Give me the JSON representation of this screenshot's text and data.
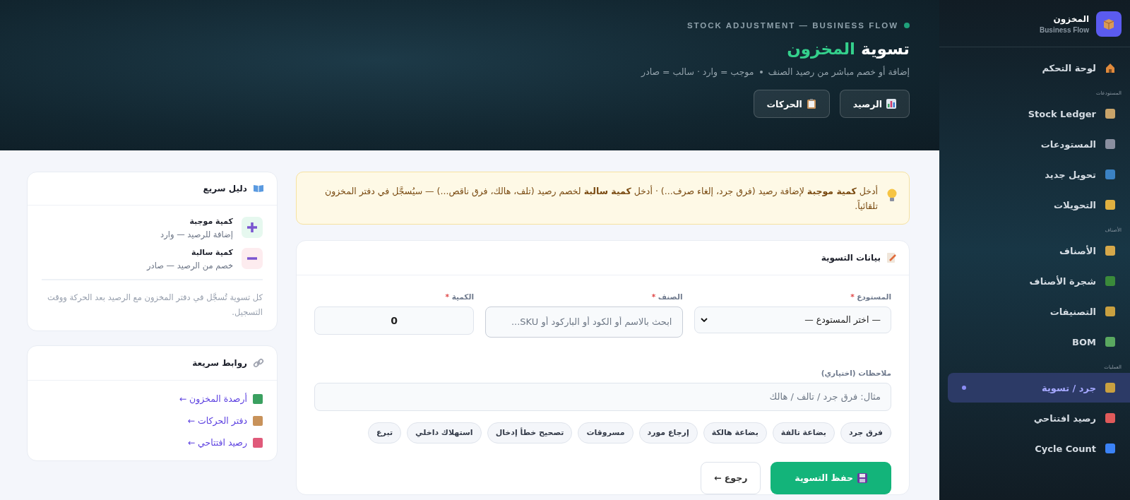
{
  "sidebar": {
    "brand": {
      "title": "المخزون",
      "subtitle": "Business Flow"
    },
    "top_items": [
      {
        "label": "لوحة التحكم",
        "selected": false
      }
    ],
    "groups": [
      {
        "label": "المستودعات",
        "items": [
          {
            "label": "Stock Ledger",
            "selected": false
          },
          {
            "label": "المستودعات",
            "selected": false
          },
          {
            "label": "تحويل جديد",
            "selected": false
          },
          {
            "label": "التحويلات",
            "selected": false
          }
        ]
      },
      {
        "label": "الأصناف",
        "items": [
          {
            "label": "الأصناف",
            "selected": false
          },
          {
            "label": "شجرة الأصناف",
            "selected": false
          },
          {
            "label": "التصنيفات",
            "selected": false
          },
          {
            "label": "BOM",
            "selected": false
          }
        ]
      },
      {
        "label": "العمليات",
        "items": [
          {
            "label": "جرد / تسوية",
            "selected": true
          },
          {
            "label": "رصيد افتتاحي",
            "selected": false
          },
          {
            "label": "Cycle Count",
            "selected": false
          }
        ]
      }
    ]
  },
  "header": {
    "eyebrow": "STOCK ADJUSTMENT — BUSINESS FLOW",
    "title": "تسوية",
    "title_highlight": "المخزون",
    "subtitle": [
      "إضافة أو خصم مباشر من رصيد الصنف",
      "موجب = وارد · سالب = صادر"
    ],
    "buttons": [
      "الرصيد",
      "الحركات"
    ]
  },
  "alert": "أدخل **كمية موجبة** لإضافة رصيد (فرق جرد، إلغاء صرف...) · أدخل **كمية سالبة** لخصم رصيد (تلف، هالك، فرق ناقص...) — سيُسجَّل في دفتر المخزون تلقائياً.",
  "form": {
    "title": "بيانات التسوية",
    "warehouse": {
      "label": "المستودع",
      "required_mark": "*",
      "value": "— اختر المستودع —"
    },
    "item": {
      "label": "الصنف",
      "required_mark": "*",
      "placeholder": "ابحث بالاسم أو الكود أو الباركود أو SKU..."
    },
    "quantity": {
      "label": "الكمية",
      "required_mark": "*",
      "value": "0"
    },
    "notes": {
      "label": "ملاحظات (اختياري)",
      "placeholder": "مثال: فرق جرد / تالف / هالك"
    },
    "chips": [
      "فرق جرد",
      "بضاعة تالفة",
      "بضاعة هالكة",
      "إرجاع مورد",
      "مسروقات",
      "تصحيح خطأ إدخال",
      "استهلاك داخلي",
      "تبرع"
    ],
    "buttons": [
      {
        "kind": "primary",
        "label": "حفظ التسوية"
      },
      {
        "kind": "secondary",
        "label": "رجوع ←"
      }
    ]
  },
  "guide": {
    "title": "دليل سريع",
    "entries": [
      {
        "kind": "positive",
        "title": "كمية موجبة",
        "text": "إضافة للرصيد — وارد"
      },
      {
        "kind": "negative",
        "title": "كمية سالبة",
        "text": "خصم من الرصيد — صادر"
      }
    ],
    "note": "كل تسوية تُسجَّل في دفتر المخزون مع الرصيد بعد الحركة ووقت التسجيل."
  },
  "links": {
    "title": "روابط سريعة",
    "items": [
      "أرصدة المخزون ←",
      "دفتر الحركات ←",
      "رصيد افتتاحي ←"
    ]
  }
}
